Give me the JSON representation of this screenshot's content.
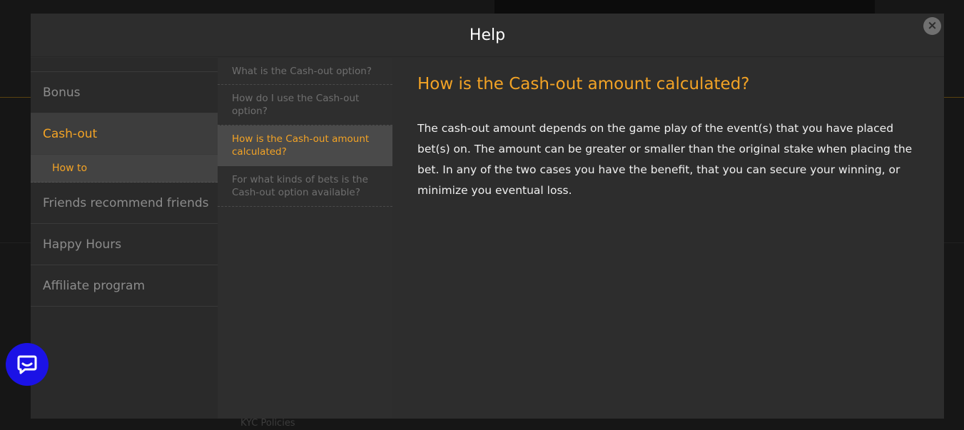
{
  "modal": {
    "title": "Help",
    "close_icon": "×"
  },
  "categories": [
    {
      "label": "Bonus",
      "active": false
    },
    {
      "label": "Cash-out",
      "active": true,
      "subitem": "How to"
    },
    {
      "label": "Friends recommend friends",
      "active": false
    },
    {
      "label": "Happy Hours",
      "active": false
    },
    {
      "label": "Affiliate program",
      "active": false
    }
  ],
  "questions": [
    {
      "label": "What is the Cash-out option?",
      "active": false
    },
    {
      "label": "How do I use the Cash-out option?",
      "active": false
    },
    {
      "label": "How is the Cash-out amount calculated?",
      "active": true
    },
    {
      "label": "For what kinds of bets is the Cash-out option available?",
      "active": false
    }
  ],
  "answer": {
    "title": "How is the Cash-out amount calculated?",
    "body": "The cash-out amount depends on the game play of the event(s) that you have placed bet(s) on. The amount can be greater or smaller than the original stake when placing the bet. In any of the two cases you have the benefit, that you can secure your winning, or minimize you eventual loss."
  },
  "background": {
    "footer_link": "KYC Policies"
  },
  "colors": {
    "accent": "#f3a325",
    "chat_button": "#1b12e6",
    "modal_bg": "#2d2d2d"
  },
  "icons": {
    "close": "close-icon",
    "chat": "chat-bubble-icon"
  }
}
